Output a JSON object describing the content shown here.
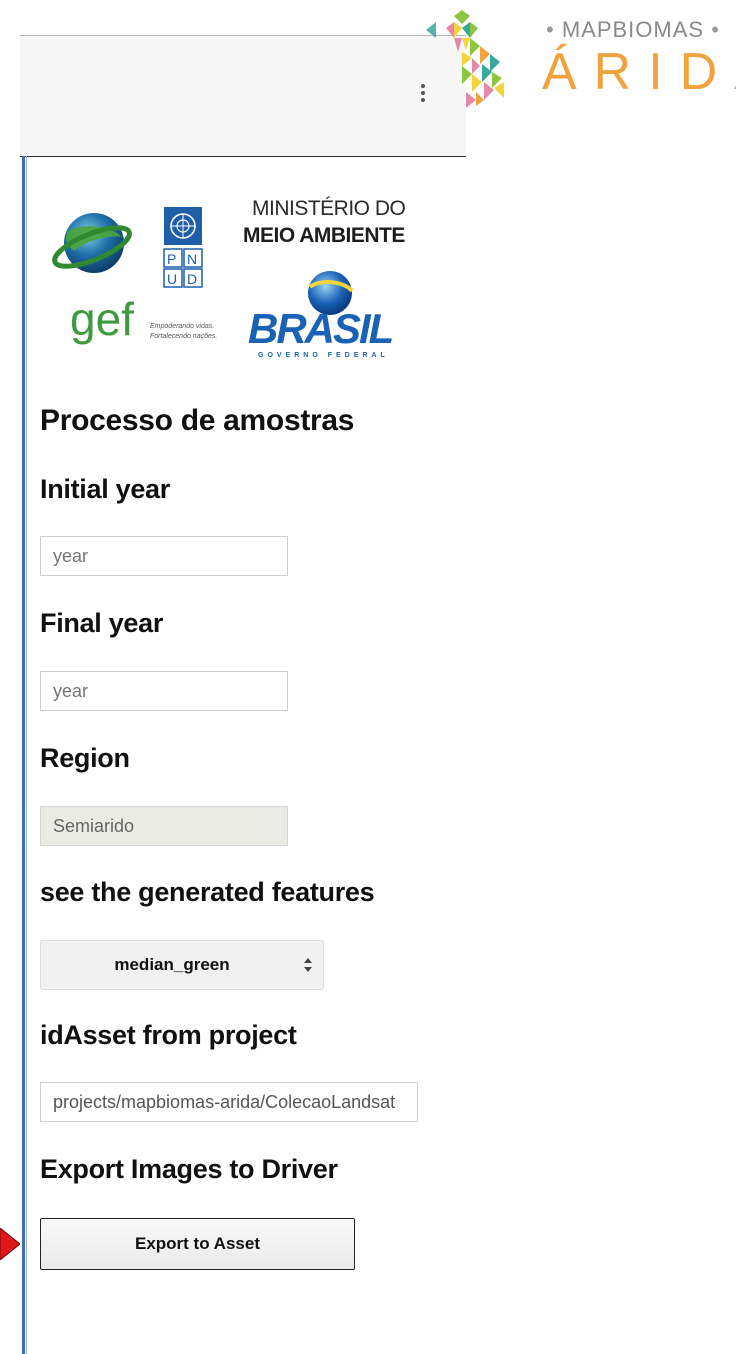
{
  "brand": {
    "subtitle_left": "•",
    "subtitle_name": "MAPBIOMAS",
    "subtitle_right": "•",
    "title": "ÁRIDA",
    "colors": {
      "accent": "#f0a33c",
      "green": "#8cc63f",
      "teal": "#37a89b",
      "pink": "#e48aa8",
      "yellow": "#f5d33a"
    }
  },
  "toolbar": {
    "menu_icon": "more-vert-icon"
  },
  "logos": {
    "gef_text": "gef",
    "pnud_letters": [
      "P",
      "N",
      "U",
      "D"
    ],
    "pnud_caption_1": "Empoderando vidas.",
    "pnud_caption_2": "Fortalecendo nações.",
    "ministry_line1": "MINISTÉRIO DO",
    "ministry_line2": "MEIO AMBIENTE",
    "brasil_text": "BRASIL",
    "brasil_sub": "GOVERNO FEDERAL"
  },
  "panel": {
    "title": "Processo de amostras",
    "initial_year": {
      "label": "Initial year",
      "placeholder": "year"
    },
    "final_year": {
      "label": "Final year",
      "placeholder": "year"
    },
    "region": {
      "label": "Region",
      "value": "Semiarido"
    },
    "features": {
      "label": "see the generated features",
      "selected": "median_green"
    },
    "asset": {
      "label": "idAsset from project",
      "value": "projects/mapbiomas-arida/ColecaoLandsat"
    },
    "export": {
      "label": "Export Images to Driver",
      "button": "Export to Asset"
    }
  }
}
